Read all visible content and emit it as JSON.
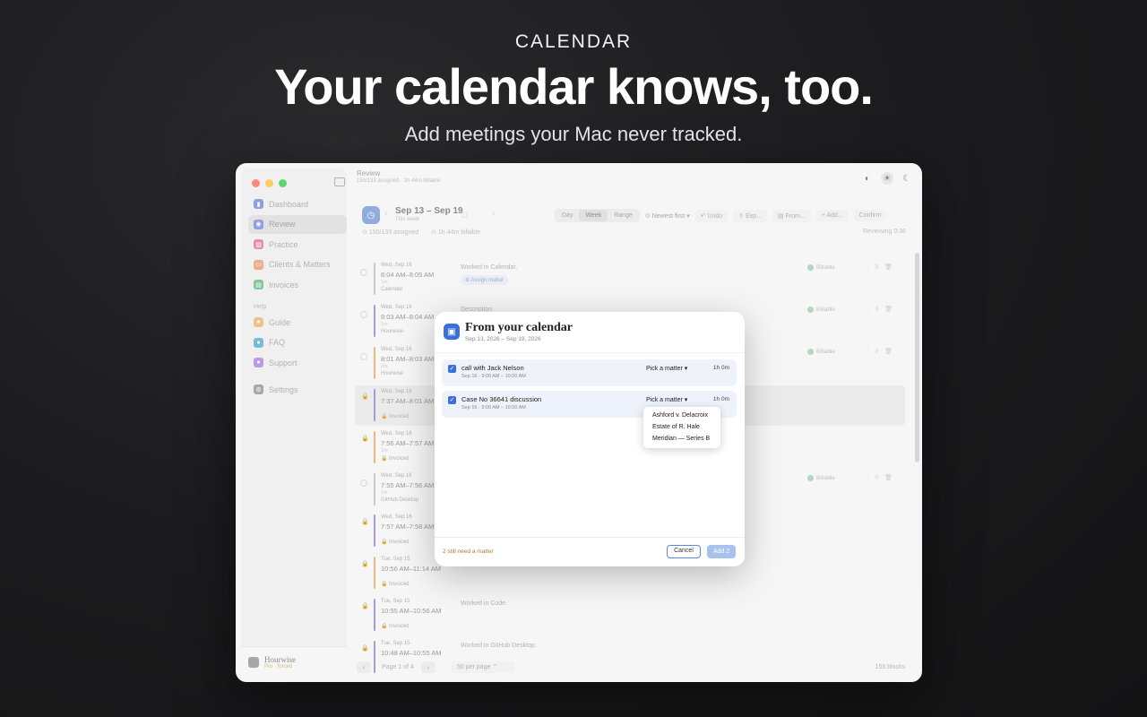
{
  "hero": {
    "eyebrow": "CALENDAR",
    "title": "Your calendar knows, too.",
    "subtitle": "Add meetings your Mac never tracked."
  },
  "window": {
    "title": "Review",
    "subtitle": "150/133 assigned · 1h 44m billable"
  },
  "sidebar": {
    "items": [
      {
        "label": "Dashboard",
        "color": "#6c7fd6"
      },
      {
        "label": "Review",
        "color": "#6c7fd6"
      },
      {
        "label": "Practice",
        "color": "#d66c86"
      },
      {
        "label": "Clients & Matters",
        "color": "#e8925e"
      },
      {
        "label": "Invoices",
        "color": "#5fb07a"
      }
    ],
    "help_section": "Help",
    "help_items": [
      {
        "label": "Guide",
        "color": "#e8b05e"
      },
      {
        "label": "FAQ",
        "color": "#4aa6c9"
      },
      {
        "label": "Support",
        "color": "#a07ad6"
      }
    ],
    "settings": "Settings",
    "footer_title": "Hourwise",
    "footer_plan": "Pro · forced"
  },
  "header": {
    "range": "Sep 13 – Sep 19",
    "range_sub": "This week",
    "assigned": "150/133 assigned",
    "billable": "1h 44m billable",
    "reviewing": "Reviewing 0:36",
    "views": [
      "Day",
      "Week",
      "Range"
    ],
    "sort": "Newest first",
    "undo": "Undo",
    "export": "Exp...",
    "from": "From...",
    "add": "Add...",
    "confirm": "Confirm"
  },
  "rows": [
    {
      "date": "Wed, Sep 16",
      "time": "8:04 AM–8:05 AM",
      "dur": "1m",
      "src": "Calendar",
      "color": "#bbbbbb",
      "desc": "Worked in Calendar.",
      "assign": "Assign matter",
      "billable": "Billable",
      "locked": false
    },
    {
      "date": "Wed, Sep 16",
      "time": "8:03 AM–8:04 AM",
      "dur": "1m",
      "src": "Hourwise",
      "color": "#8d7ac9",
      "desc": "Description",
      "billable": "Billable",
      "locked": false
    },
    {
      "date": "Wed, Sep 16",
      "time": "8:01 AM–8:03 AM",
      "dur": "2m",
      "src": "Hourwise",
      "color": "#e0a25e",
      "desc": "",
      "billable": "Billable",
      "locked": false
    },
    {
      "date": "Wed, Sep 16",
      "time": "7:37 AM–8:01 AM",
      "dur": "",
      "src": "Invoiced",
      "color": "#8d7ac9",
      "desc": "",
      "billable": "",
      "locked": true
    },
    {
      "date": "Wed, Sep 16",
      "time": "7:56 AM–7:57 AM",
      "dur": "1m",
      "src": "Invoiced",
      "color": "#e0a25e",
      "desc": "",
      "billable": "",
      "locked": true
    },
    {
      "date": "Wed, Sep 16",
      "time": "7:55 AM–7:56 AM",
      "dur": "1m",
      "src": "GitHub Desktop",
      "color": "#bbbbbb",
      "desc": "",
      "billable": "Billable",
      "locked": false
    },
    {
      "date": "Wed, Sep 16",
      "time": "7:57 AM–7:58 AM",
      "dur": "",
      "src": "Invoiced",
      "color": "#8d7ac9",
      "desc": "",
      "billable": "",
      "locked": true
    },
    {
      "date": "Tue, Sep 15",
      "time": "10:56 AM–11:14 AM",
      "dur": "",
      "src": "Invoiced",
      "color": "#e0a25e",
      "desc": "",
      "billable": "",
      "locked": true
    },
    {
      "date": "Tue, Sep 15",
      "time": "10:55 AM–10:56 AM",
      "dur": "",
      "src": "Invoiced",
      "color": "#8d7ac9",
      "desc": "Worked in Code.",
      "billable": "",
      "locked": true
    },
    {
      "date": "Tue, Sep 15",
      "time": "10:48 AM–10:55 AM",
      "dur": "",
      "src": "",
      "color": "#8d7ac9",
      "desc": "Worked in GitHub Desktop.",
      "billable": "",
      "locked": true
    }
  ],
  "footer": {
    "page": "Page 1 of 4",
    "per_page": "50 per page",
    "blocks": "155 blocks"
  },
  "modal": {
    "title": "From your calendar",
    "subtitle": "Sep 13, 2026 – Sep 19, 2026",
    "events": [
      {
        "name": "call with Jack Nelson",
        "time": "Sep 16 · 9:00 AM – 10:00 AM",
        "pick": "Pick a matter",
        "dur": "1h 0m"
      },
      {
        "name": "Case No 36641 discussion",
        "time": "Sep 16 · 9:00 AM – 10:00 AM",
        "pick": "Pick a matter",
        "dur": "1h 0m"
      }
    ],
    "options": [
      "Ashford v. Delacroix",
      "Estate of R. Hale",
      "Meridian — Series B"
    ],
    "need": "2 still need a matter",
    "cancel": "Cancel",
    "add": "Add 2"
  }
}
